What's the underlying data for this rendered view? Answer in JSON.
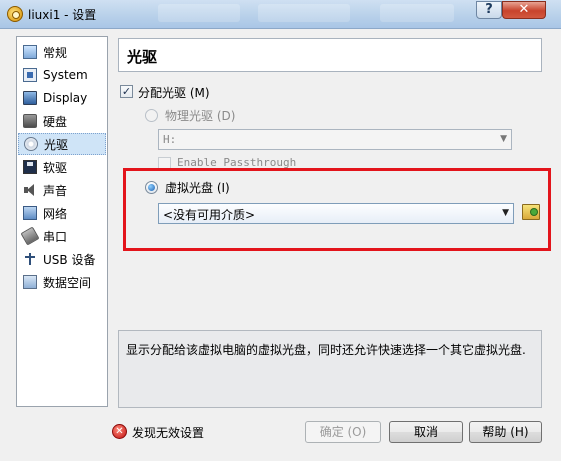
{
  "window": {
    "title": "liuxi1 - 设置",
    "help_glyph": "?",
    "close_glyph": "✕"
  },
  "nav": {
    "items": [
      {
        "label": "常规",
        "icon": "general-icon"
      },
      {
        "label": "System",
        "icon": "system-icon"
      },
      {
        "label": "Display",
        "icon": "display-icon"
      },
      {
        "label": "硬盘",
        "icon": "storage-icon"
      },
      {
        "label": "光驱",
        "icon": "optical-drive-icon"
      },
      {
        "label": "软驱",
        "icon": "floppy-icon"
      },
      {
        "label": "声音",
        "icon": "audio-icon"
      },
      {
        "label": "网络",
        "icon": "network-icon"
      },
      {
        "label": "串口",
        "icon": "serial-port-icon"
      },
      {
        "label": "USB 设备",
        "icon": "usb-icon"
      },
      {
        "label": "数据空间",
        "icon": "shared-folder-icon"
      }
    ],
    "selected": "光驱"
  },
  "main": {
    "section_title": "光驱",
    "mount_drive": {
      "label": "分配光驱 (M)",
      "checked": true
    },
    "host_drive": {
      "label": "物理光驱 (D)",
      "selected": false,
      "enabled": false
    },
    "host_drive_combo": {
      "value": "H:",
      "enabled": false
    },
    "passthrough": {
      "label": "Enable Passthrough",
      "checked": false,
      "enabled": false
    },
    "image_file": {
      "label": "虚拟光盘 (I)",
      "selected": true
    },
    "image_combo": {
      "value": "<没有可用介质>"
    },
    "browse_icon": "folder-open-icon",
    "description": "显示分配给该虚拟电脑的虚拟光盘，同时还允许快速选择一个其它虚拟光盘."
  },
  "footer": {
    "warning": "发现无效设置",
    "warning_icon": "error-icon",
    "ok_label": "确定 (O)",
    "cancel_label": "取消",
    "help_label": "帮助 (H)"
  },
  "colors": {
    "highlight": "#e3141b",
    "selection": "#cfe4f7"
  }
}
